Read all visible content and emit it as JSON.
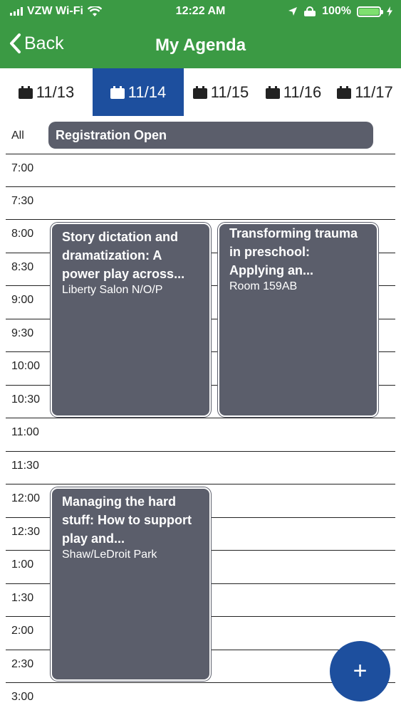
{
  "status_bar": {
    "carrier": "VZW Wi-Fi",
    "time": "12:22 AM",
    "battery": "100%",
    "icons": [
      "signal-bars-icon",
      "wifi-icon",
      "location-arrow-icon",
      "alarm-icon",
      "battery-icon",
      "charging-bolt-icon"
    ],
    "battery_level": 1.0
  },
  "nav": {
    "back_label": "Back",
    "title": "My Agenda"
  },
  "dates": [
    {
      "label": "11/13",
      "active": false
    },
    {
      "label": "11/14",
      "active": true
    },
    {
      "label": "11/15",
      "active": false
    },
    {
      "label": "11/16",
      "active": false
    },
    {
      "label": "11/17",
      "active": false
    }
  ],
  "all_day": {
    "label": "All",
    "event": "Registration Open"
  },
  "times": [
    "7:00",
    "7:30",
    "8:00",
    "8:30",
    "9:00",
    "9:30",
    "10:00",
    "10:30",
    "11:00",
    "11:30",
    "12:00",
    "12:30",
    "1:00",
    "1:30",
    "2:00",
    "2:30",
    "3:00"
  ],
  "events": [
    {
      "title": "Story dictation and dramatization: A power play across...",
      "location": "Liberty Salon N/O/P"
    },
    {
      "title": "Transforming trauma in preschool: Applying an...",
      "location": "Room 159AB"
    },
    {
      "title": "Managing the hard stuff: How to support play and...",
      "location": "Shaw/LeDroit Park"
    }
  ],
  "fab": {
    "label": "+"
  },
  "colors": {
    "header": "#3b9a44",
    "active_tab": "#1d4f9e",
    "event_bg": "#5b5e6b",
    "fab": "#1d4f9e"
  }
}
